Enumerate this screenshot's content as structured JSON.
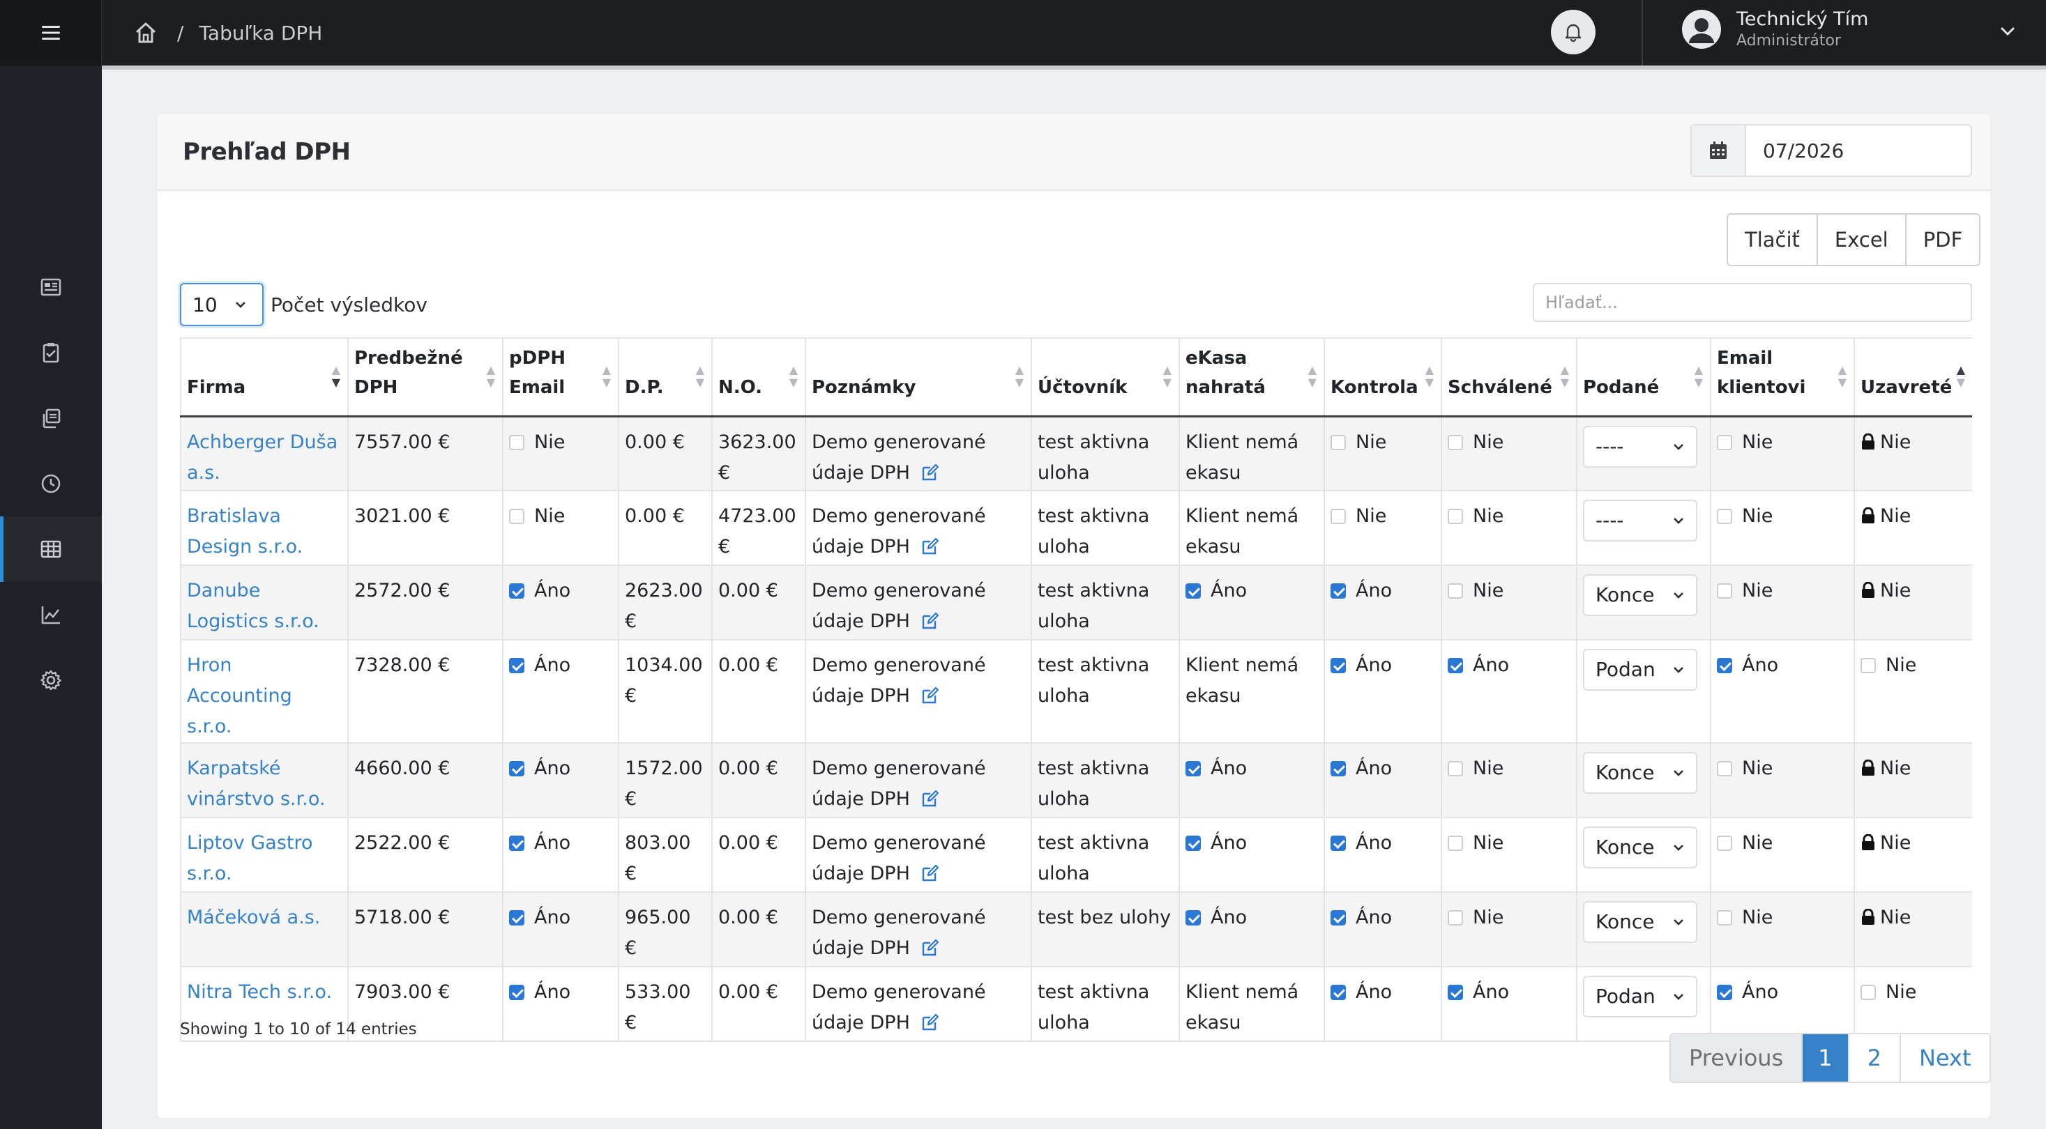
{
  "topbar": {
    "breadcrumb": "Tabuľka DPH",
    "user_name": "Technický Tím",
    "user_role": "Administrátor"
  },
  "sidebar": {
    "items": [
      {
        "icon": "newspaper-icon"
      },
      {
        "icon": "clipboard-check-icon"
      },
      {
        "icon": "copy-icon"
      },
      {
        "icon": "clock-icon"
      },
      {
        "icon": "table-icon",
        "active": true
      },
      {
        "icon": "chart-line-icon"
      },
      {
        "icon": "gear-icon"
      }
    ]
  },
  "card": {
    "title": "Prehľad DPH",
    "period": "07/2026",
    "export_buttons": [
      "Tlačiť",
      "Excel",
      "PDF"
    ],
    "length_value": "10",
    "length_label": "Počet výsledkov",
    "search_placeholder": "Hľadať..."
  },
  "table": {
    "columns": [
      {
        "key": "firma",
        "lines": [
          "Firma"
        ]
      },
      {
        "key": "predbezne",
        "lines": [
          "Predbežné",
          "DPH"
        ]
      },
      {
        "key": "pdph",
        "lines": [
          "pDPH",
          "Email"
        ]
      },
      {
        "key": "dp",
        "lines": [
          "D.P."
        ]
      },
      {
        "key": "no",
        "lines": [
          "N.O."
        ]
      },
      {
        "key": "poznamky",
        "lines": [
          "Poznámky"
        ]
      },
      {
        "key": "uctovnik",
        "lines": [
          "Účtovník"
        ]
      },
      {
        "key": "ekasa",
        "lines": [
          "eKasa",
          "nahratá"
        ]
      },
      {
        "key": "kontrola",
        "lines": [
          "Kontrola"
        ]
      },
      {
        "key": "schvalene",
        "lines": [
          "Schválené"
        ]
      },
      {
        "key": "podane",
        "lines": [
          "Podané"
        ]
      },
      {
        "key": "email",
        "lines": [
          "Email",
          "klientovi"
        ]
      },
      {
        "key": "uzavrete",
        "lines": [
          "Uzavreté"
        ]
      }
    ],
    "rows": [
      {
        "firma": "Achberger Duša a.s.",
        "predbezne": "7557.00 €",
        "pdph": false,
        "pdph_text": "Nie",
        "dp": "0.00 €",
        "no": "3623.00 €",
        "poznamka": "Demo generované údaje DPH",
        "uctovnik": "test aktivna uloha",
        "ekasa_chk": null,
        "ekasa_text": "Klient nemá ekasu",
        "kontrola": false,
        "kontrola_text": "Nie",
        "schvalene": false,
        "schvalene_text": "Nie",
        "podane": "----",
        "email": false,
        "email_text": "Nie",
        "uzavrete_locked": true,
        "uzavrete_text": "Nie"
      },
      {
        "firma": "Bratislava Design s.r.o.",
        "predbezne": "3021.00 €",
        "pdph": false,
        "pdph_text": "Nie",
        "dp": "0.00 €",
        "no": "4723.00 €",
        "poznamka": "Demo generované údaje DPH",
        "uctovnik": "test aktivna uloha",
        "ekasa_chk": null,
        "ekasa_text": "Klient nemá ekasu",
        "kontrola": false,
        "kontrola_text": "Nie",
        "schvalene": false,
        "schvalene_text": "Nie",
        "podane": "----",
        "email": false,
        "email_text": "Nie",
        "uzavrete_locked": true,
        "uzavrete_text": "Nie"
      },
      {
        "firma": "Danube Logistics s.r.o.",
        "predbezne": "2572.00 €",
        "pdph": true,
        "pdph_text": "Áno",
        "dp": "2623.00 €",
        "no": "0.00 €",
        "poznamka": "Demo generované údaje DPH",
        "uctovnik": "test aktivna uloha",
        "ekasa_chk": true,
        "ekasa_text": "Áno",
        "kontrola": true,
        "kontrola_text": "Áno",
        "schvalene": false,
        "schvalene_text": "Nie",
        "podane": "Konce",
        "email": false,
        "email_text": "Nie",
        "uzavrete_locked": true,
        "uzavrete_text": "Nie"
      },
      {
        "firma": "Hron Accounting s.r.o.",
        "predbezne": "7328.00 €",
        "pdph": true,
        "pdph_text": "Áno",
        "dp": "1034.00 €",
        "no": "0.00 €",
        "poznamka": "Demo generované údaje DPH",
        "uctovnik": "test aktivna uloha",
        "ekasa_chk": null,
        "ekasa_text": "Klient nemá ekasu",
        "kontrola": true,
        "kontrola_text": "Áno",
        "schvalene": true,
        "schvalene_text": "Áno",
        "podane": "Podan",
        "email": true,
        "email_text": "Áno",
        "uzavrete_locked": false,
        "uzavrete_text": "Nie"
      },
      {
        "firma": "Karpatské vinárstvo s.r.o.",
        "predbezne": "4660.00 €",
        "pdph": true,
        "pdph_text": "Áno",
        "dp": "1572.00 €",
        "no": "0.00 €",
        "poznamka": "Demo generované údaje DPH",
        "uctovnik": "test aktivna uloha",
        "ekasa_chk": true,
        "ekasa_text": "Áno",
        "kontrola": true,
        "kontrola_text": "Áno",
        "schvalene": false,
        "schvalene_text": "Nie",
        "podane": "Konce",
        "email": false,
        "email_text": "Nie",
        "uzavrete_locked": true,
        "uzavrete_text": "Nie"
      },
      {
        "firma": "Liptov Gastro s.r.o.",
        "predbezne": "2522.00 €",
        "pdph": true,
        "pdph_text": "Áno",
        "dp": "803.00 €",
        "no": "0.00 €",
        "poznamka": "Demo generované údaje DPH",
        "uctovnik": "test aktivna uloha",
        "ekasa_chk": true,
        "ekasa_text": "Áno",
        "kontrola": true,
        "kontrola_text": "Áno",
        "schvalene": false,
        "schvalene_text": "Nie",
        "podane": "Konce",
        "email": false,
        "email_text": "Nie",
        "uzavrete_locked": true,
        "uzavrete_text": "Nie"
      },
      {
        "firma": "Máčeková a.s.",
        "predbezne": "5718.00 €",
        "pdph": true,
        "pdph_text": "Áno",
        "dp": "965.00 €",
        "no": "0.00 €",
        "poznamka": "Demo generované údaje DPH",
        "uctovnik": "test bez ulohy",
        "ekasa_chk": true,
        "ekasa_text": "Áno",
        "kontrola": true,
        "kontrola_text": "Áno",
        "schvalene": false,
        "schvalene_text": "Nie",
        "podane": "Konce",
        "email": false,
        "email_text": "Nie",
        "uzavrete_locked": true,
        "uzavrete_text": "Nie"
      },
      {
        "firma": "Nitra Tech s.r.o.",
        "predbezne": "7903.00 €",
        "pdph": true,
        "pdph_text": "Áno",
        "dp": "533.00 €",
        "no": "0.00 €",
        "poznamka": "Demo generované údaje DPH",
        "uctovnik": "test aktivna uloha",
        "ekasa_chk": null,
        "ekasa_text": "Klient nemá ekasu",
        "kontrola": true,
        "kontrola_text": "Áno",
        "schvalene": true,
        "schvalene_text": "Áno",
        "podane": "Podan",
        "email": true,
        "email_text": "Áno",
        "uzavrete_locked": false,
        "uzavrete_text": "Nie"
      }
    ]
  },
  "footer": {
    "info": "Showing 1 to 10 of 14 entries",
    "pagination": {
      "previous": "Previous",
      "pages": [
        "1",
        "2"
      ],
      "next": "Next"
    }
  },
  "colors": {
    "link": "#3582c8",
    "checkbox_on": "#2b78d4",
    "sidebar_bg": "#1e2226",
    "topbar_bg": "#1c1f22",
    "active_indicator": "#2f8fde"
  }
}
